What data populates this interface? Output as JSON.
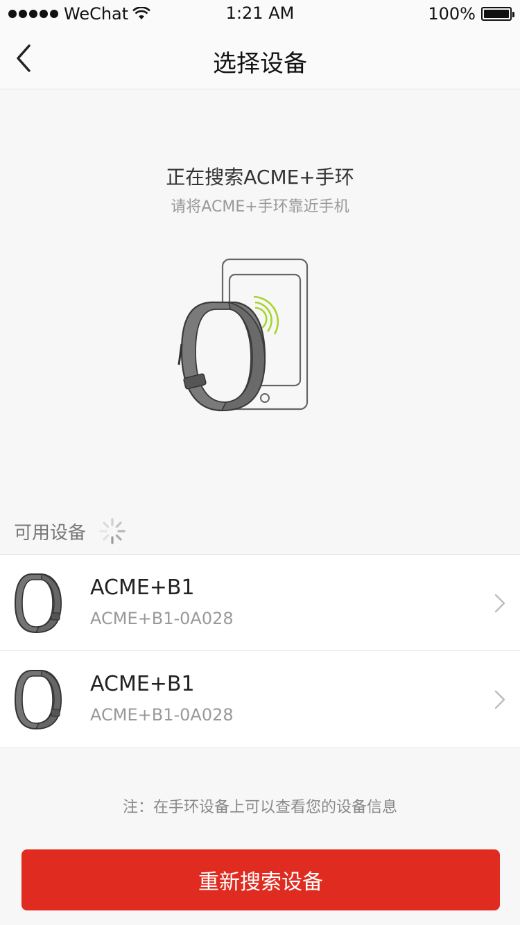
{
  "status_bar": {
    "carrier": "WeChat",
    "time": "1:21 AM",
    "battery": "100%"
  },
  "nav": {
    "title": "选择设备"
  },
  "search": {
    "title": "正在搜索ACME+手环",
    "subtitle": "请将ACME+手环靠近手机"
  },
  "available": {
    "label": "可用设备"
  },
  "devices": [
    {
      "name": "ACME+B1",
      "id": "ACME+B1-0A028"
    },
    {
      "name": "ACME+B1",
      "id": "ACME+B1-0A028"
    }
  ],
  "note": "注：在手环设备上可以查看您的设备信息",
  "research_button": "重新搜索设备",
  "colors": {
    "accent": "#e02c20",
    "signal_waves": "#a6d42e",
    "band": "#6f6f6f"
  },
  "icons": [
    "back-chevron-icon",
    "wifi-icon",
    "battery-icon",
    "spinner-icon",
    "chevron-right-icon",
    "band-icon",
    "phone-icon"
  ]
}
